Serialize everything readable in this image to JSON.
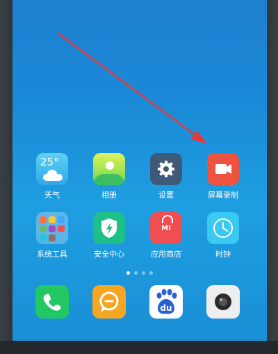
{
  "home": {
    "row1": [
      {
        "label": "天气",
        "icon": "weather-icon",
        "temp": "25°"
      },
      {
        "label": "相册",
        "icon": "gallery-icon"
      },
      {
        "label": "设置",
        "icon": "gear-icon"
      },
      {
        "label": "屏幕录制",
        "icon": "screen-record-icon"
      }
    ],
    "row2": [
      {
        "label": "系统工具",
        "icon": "folder-icon"
      },
      {
        "label": "安全中心",
        "icon": "security-shield-icon"
      },
      {
        "label": "应用商店",
        "icon": "app-store-icon",
        "logo": "MI"
      },
      {
        "label": "时钟",
        "icon": "clock-icon"
      }
    ],
    "page_indicator": {
      "total": 4,
      "active": 0
    },
    "dock": [
      {
        "icon": "phone-icon"
      },
      {
        "icon": "messages-icon"
      },
      {
        "icon": "baidu-icon",
        "logo": "du"
      },
      {
        "icon": "camera-icon"
      }
    ]
  },
  "colors": {
    "wallpaper": "#1b8ad8",
    "arrow": "#e53935",
    "record_tile": "#ef5340",
    "security_tile": "#1ec08a",
    "store_tile": "#ef4f52",
    "phone_tile": "#22c864",
    "messages_tile": "#f5a623",
    "camera_tile": "#eeeeee"
  }
}
